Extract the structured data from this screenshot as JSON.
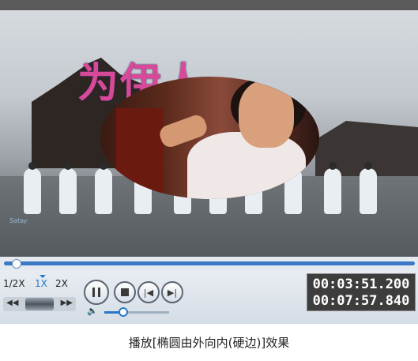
{
  "video": {
    "watermark_text": "Satay"
  },
  "player": {
    "collapse_glyph": "⌄",
    "speed_options": [
      "1/2X",
      "1X",
      "2X"
    ],
    "speed_selected": "1X",
    "rewind_glyph": "◀◀",
    "forward_glyph": "▶▶",
    "prev_glyph": "|◀",
    "next_glyph": "▶|",
    "volume_glyph": "🔈",
    "current_time": "00:03:51.200",
    "total_time": "00:07:57.840",
    "progress_fraction": 0.02,
    "volume_fraction": 0.25
  },
  "caption": "播放[椭圆由外向内(硬边)]效果",
  "colors": {
    "accent": "#2a77c9",
    "time_bg": "#3d3d3d"
  }
}
